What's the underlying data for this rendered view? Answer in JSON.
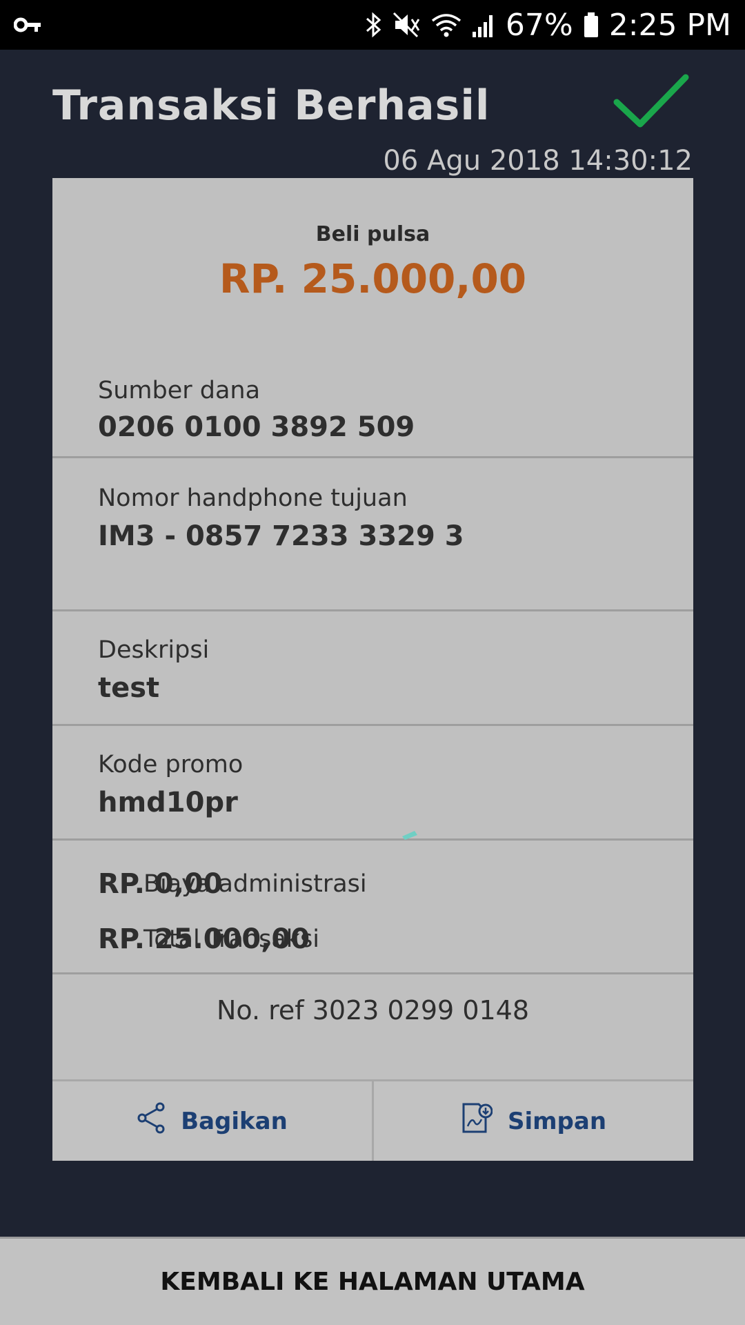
{
  "status_bar": {
    "battery_percent": "67%",
    "time": "2:25 PM"
  },
  "header": {
    "title": "Transaksi Berhasil",
    "timestamp": "06 Agu 2018 14:30:12"
  },
  "receipt": {
    "product_label": "Beli pulsa",
    "product_amount": "RP. 25.000,00",
    "rows": [
      {
        "label": "Sumber dana",
        "value": "0206 0100 3892 509"
      },
      {
        "label": "Nomor handphone tujuan",
        "value": "IM3 - 0857  7233  3329  3"
      },
      {
        "label": "Deskripsi",
        "value": "test"
      },
      {
        "label": "Kode promo",
        "value": "hmd10pr"
      }
    ],
    "fees": [
      {
        "label": "Biaya administrasi",
        "value": "RP. 0,00"
      },
      {
        "label": "Total Transaksi",
        "value": "RP. 25.000,00"
      }
    ],
    "reference": "No. ref 3023 0299 0148"
  },
  "actions": {
    "share_label": "Bagikan",
    "save_label": "Simpan"
  },
  "footer": {
    "home_label": "KEMBALI KE HALAMAN UTAMA"
  },
  "colors": {
    "background": "#1e2331",
    "card": "#c0c0c0",
    "amount": "#b55a1c",
    "accent_blue": "#1c3f73",
    "success_green": "#1aa64b"
  },
  "icons": [
    "key-icon",
    "bluetooth-icon",
    "mute-icon",
    "wifi-icon",
    "signal-icon",
    "battery-icon",
    "checkmark-icon",
    "share-icon",
    "save-pdf-icon"
  ]
}
